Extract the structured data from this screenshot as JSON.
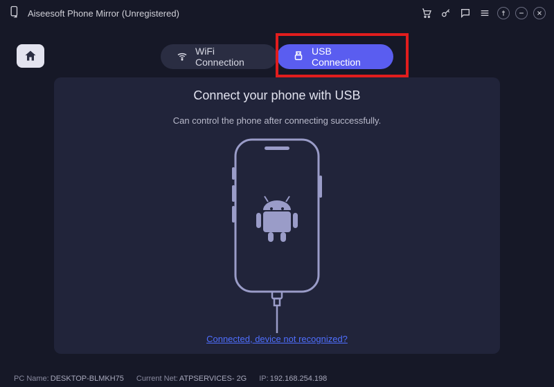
{
  "app": {
    "title": "Aiseesoft Phone Mirror (Unregistered)"
  },
  "tabs": {
    "wifi": "WiFi Connection",
    "usb": "USB Connection"
  },
  "main": {
    "heading": "Connect your phone with USB",
    "subtext": "Can control the phone after connecting successfully.",
    "help_link": "Connected, device not recognized?"
  },
  "status": {
    "pc_label": "PC Name:",
    "pc_value": "DESKTOP-BLMKH75",
    "net_label": "Current Net:",
    "net_value": "ATPSERVICES- 2G",
    "ip_label": "IP:",
    "ip_value": "192.168.254.198"
  },
  "titlebar_icons": {
    "cart": "cart-icon",
    "key": "key-icon",
    "chat": "chat-icon",
    "menu": "menu-icon",
    "pin": "pin-icon",
    "min": "minimize-icon",
    "close": "close-icon"
  }
}
